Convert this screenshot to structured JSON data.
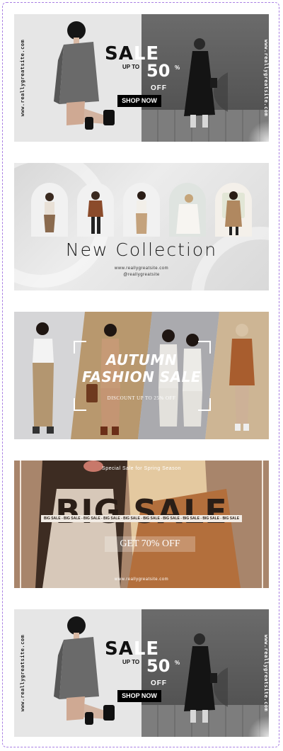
{
  "banner_sale": {
    "website": "www.reallygreatsite.com",
    "title_dark": "SA",
    "title_light": "LE",
    "up_to": "UP TO",
    "percent": "50",
    "percent_sign": "%",
    "off": "OFF",
    "cta": "SHOP NOW"
  },
  "banner_collection": {
    "headline": "New Collection",
    "website": "www.reallygreatsite.com",
    "handle": "@reallygreatsite"
  },
  "banner_autumn": {
    "title_line1": "AUTUMN",
    "title_line2": "FASHION SALE",
    "discount": "DISCOUNT UP TO 25% OFF"
  },
  "banner_big_sale": {
    "tagline": "Special Sale for Spring Season",
    "headline": "BIG SALE",
    "ticker": "BIG SALE - BIG SALE - BIG SALE - BIG SALE - BIG SALE - BIG SALE - BIG SALE - BIG SALE - BIG SALE - BIG SALE",
    "offer": "GET 70% OFF",
    "website": "www.reallygreatsite.com"
  },
  "colors": {
    "frame_border": "#a97fe3",
    "sale_dark": "#111111",
    "autumn_panel_tan": "#b8986e",
    "big_sale_brown": "#a8856b"
  }
}
